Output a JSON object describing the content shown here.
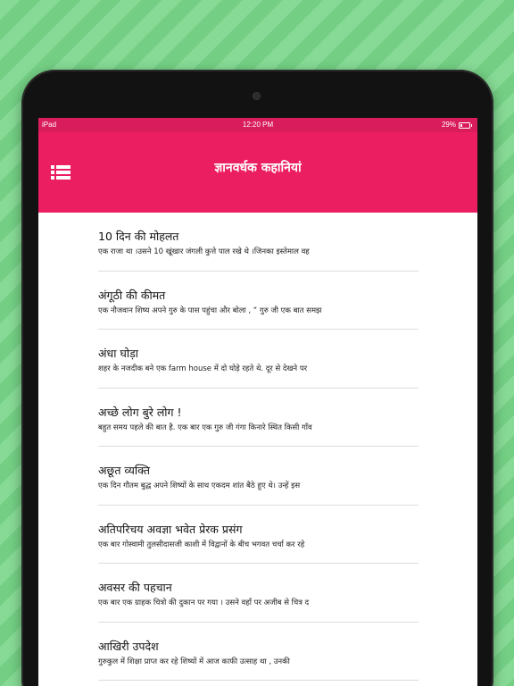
{
  "status_bar": {
    "carrier": "iPad",
    "time": "12:20 PM",
    "battery_percent": "29%",
    "battery_icon": "battery-icon"
  },
  "app_bar": {
    "title": "ज्ञानवर्धक कहानियां",
    "menu_icon": "list-menu-icon",
    "color": "#ec1e62"
  },
  "stories": [
    {
      "title": "10 दिन की मोहलत",
      "excerpt": "एक राजा था ।उसने 10 खूंखार जंगली कुत्ते पाल रखे थे ।जिनका इस्तेमाल वह"
    },
    {
      "title": "अंगूठी की कीमत",
      "excerpt": "एक नौजवान शिष्य अपने गुरु के पास पहुंचा और बोला , “ गुरु जी एक बात समझ"
    },
    {
      "title": "अंधा घोड़ा",
      "excerpt": "शहर के नजदीक बने एक farm house में दो घोड़े रहते थे. दूर से देखने पर"
    },
    {
      "title": "अच्छे लोग बुरे लोग !",
      "excerpt": "बहुत समय पहले की बात है. एक बार एक गुरु जी गंगा किनारे स्थित किसी गाँव"
    },
    {
      "title": "अछूत व्यक्ति",
      "excerpt": "एक दिन गौतम बुद्ध अपने शिष्यों के साथ एकदम शांत बैठे हुए थे। उन्हें इस"
    },
    {
      "title": "अतिपरिचय अवज्ञा भवेत प्रेरक प्रसंग",
      "excerpt": "एक बार गोस्वामी तुलसीदासजी काशी में विद्वानों के बीच भगवत चर्चा कर रहे"
    },
    {
      "title": "अवसर की पहचान",
      "excerpt": "एक बार एक ग्राहक चित्रो की दुकान पर गया । उसने वहाँ पर अजीब से चित्र द"
    },
    {
      "title": "आखिरी उपदेश",
      "excerpt": "गुरुकुल में शिक्षा प्राप्त कर रहे शिष्यों में आज काफी उत्साह था , उनकी"
    }
  ]
}
